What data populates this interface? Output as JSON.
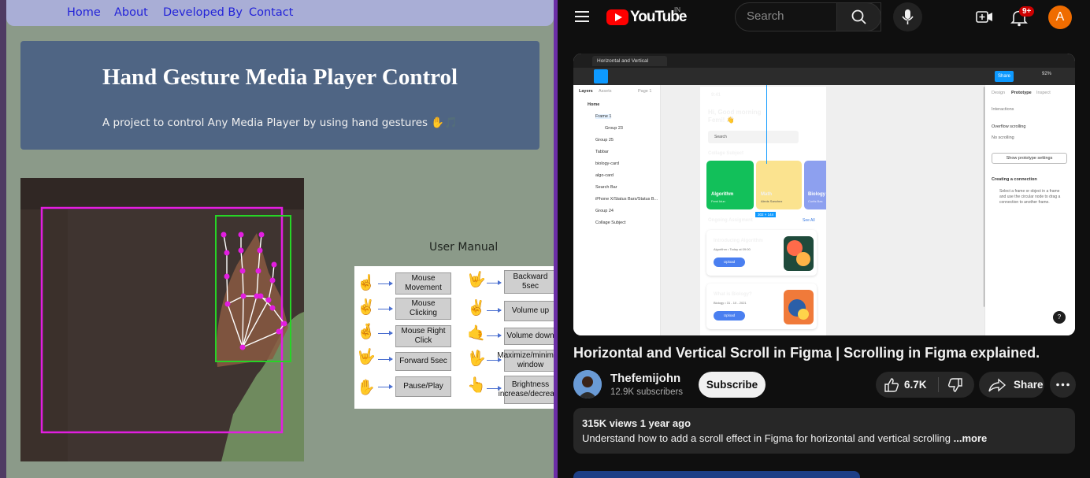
{
  "left_app": {
    "nav": [
      "Home",
      "About",
      "Developed By",
      "Contact"
    ],
    "title": "Hand Gesture Media Player Control",
    "subtitle": "A project to control Any Media Player by using hand gestures ✋🎵",
    "manual_title": "User Manual",
    "manual_left": [
      "Mouse Movement",
      "Mouse Clicking",
      "Mouse Right Click",
      "Forward 5sec",
      "Pause/Play"
    ],
    "manual_right": [
      "Backward 5sec",
      "Volume up",
      "Volume down",
      "Maximize/minimize window",
      "Brightness increase/decrease"
    ],
    "manual_left_icons": [
      "☝",
      "✌",
      "🤞",
      "🤟",
      "✋"
    ],
    "manual_right_icons": [
      "🤟",
      "✌",
      "🤙",
      "🖖",
      "👆"
    ]
  },
  "youtube": {
    "logo": "YouTube",
    "country": "IN",
    "search_placeholder": "Search",
    "notif_badge": "9+",
    "avatar_letter": "A",
    "video_title": "Horizontal and Vertical Scroll in Figma | Scrolling in Figma explained.",
    "channel_name": "Thefemijohn",
    "subscribers": "12.9K subscribers",
    "subscribe_label": "Subscribe",
    "likes": "6.7K",
    "share_label": "Share",
    "views_line": "315K views  1 year ago",
    "description": "Understand how to add a scroll effect in Figma for horizontal and vertical scrolling",
    "more_label": " ...more",
    "figma": {
      "tab": "Horizontal and Vertical Scroll",
      "share": "Share",
      "zoom": "92%",
      "layers_header": [
        "Layers",
        "Assets",
        "Page 1"
      ],
      "layers": [
        "Home",
        "Frame 1",
        "Group 23",
        "Group 25",
        "Tabbar",
        "biology-card",
        "algo-card",
        "Search Bar",
        "iPhone X/Status Bars/Status B...",
        "Group 24",
        "Collage Subject"
      ],
      "right_tabs": [
        "Design",
        "Prototype",
        "Inspect"
      ],
      "interactions": "Interactions",
      "overflow": "Overflow scrolling",
      "no_scroll": "No scrolling",
      "proto_btn": "Show prototype settings",
      "conn_title": "Creating a connection",
      "conn_text": "Select a frame or object in a frame and use the circular node to drag a connection to another frame.",
      "time": "9:41",
      "greeting": "Hi, Good morning Femi! 👋",
      "search": "Search",
      "collage": "Collage Subject",
      "cards": [
        "Algorithm",
        "Math",
        "Biology"
      ],
      "card_subs": [
        "Femi Idun",
        "Alexis Sanchez",
        "Curtis Bas"
      ],
      "size_tag": "302 × 144",
      "ongoing": "Ongoing Assigment",
      "see_all": "See All",
      "assign1": "Introducing Algorithm",
      "assign1_meta": "Algorithm  •  Today at 09:00",
      "assign2": "What is Biology?",
      "assign2_meta": "Biology  •  31 - 10 - 2021",
      "upload": "Upload"
    }
  },
  "colors": {
    "left_bg": "#8b9a89",
    "hero_bg": "#4f6584",
    "yt_bg": "#0f0f0f",
    "yt_red": "#ff0000"
  }
}
